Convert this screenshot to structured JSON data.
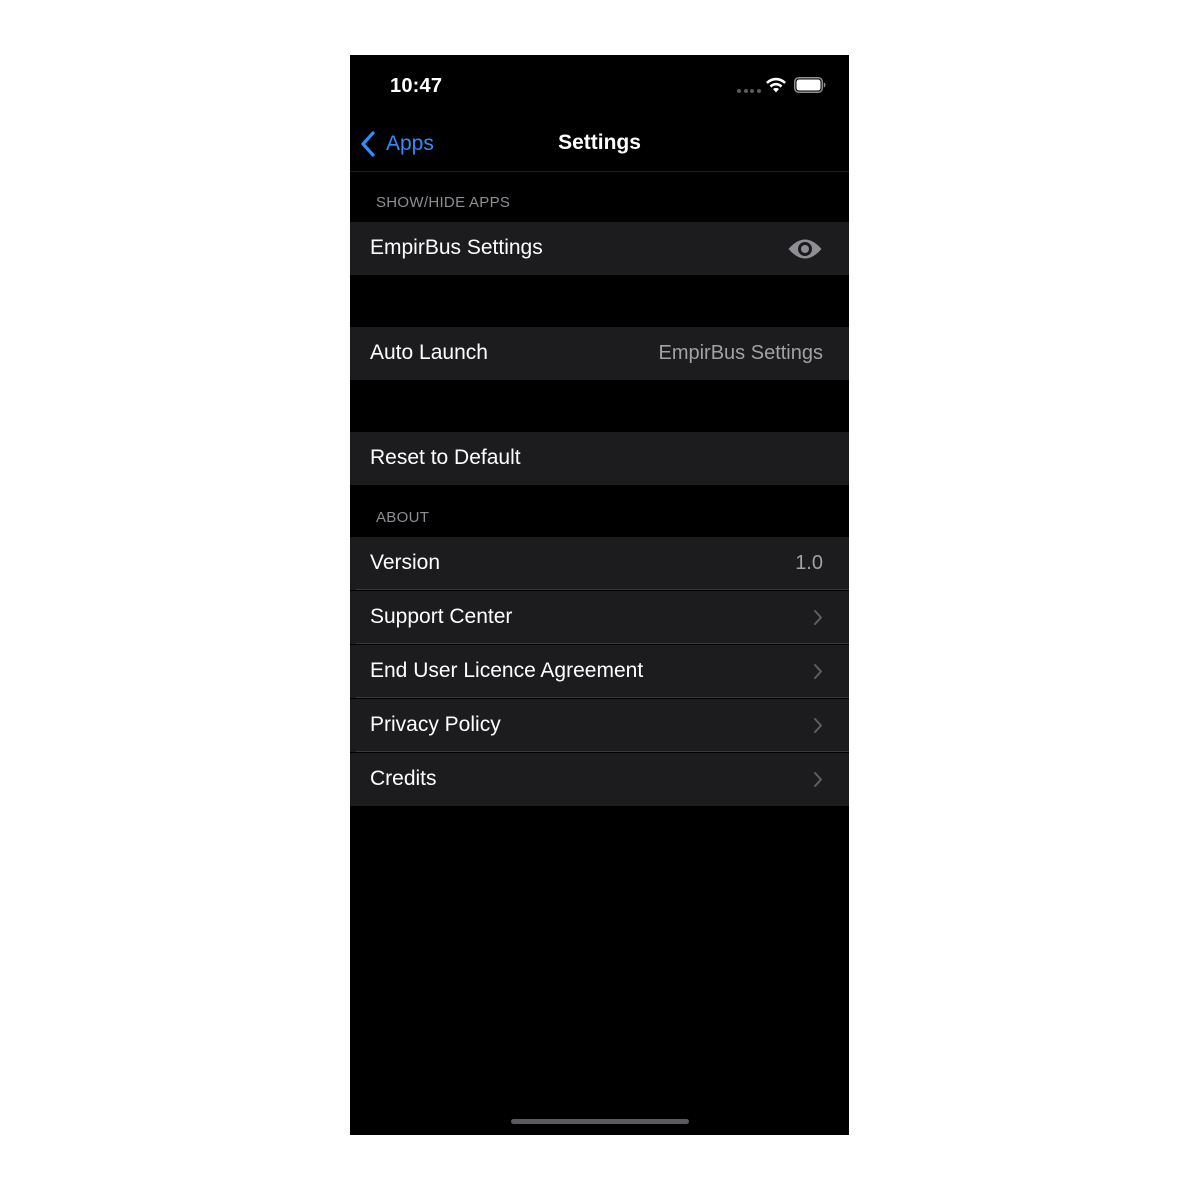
{
  "status_bar": {
    "time": "10:47"
  },
  "nav": {
    "back_label": "Apps",
    "title": "Settings"
  },
  "sections": {
    "show_hide_header": "SHOW/HIDE APPS",
    "about_header": "ABOUT"
  },
  "cells": {
    "empirbus": {
      "label": "EmpirBus Settings",
      "icon": "eye-icon"
    },
    "auto_launch": {
      "label": "Auto Launch",
      "value": "EmpirBus Settings"
    },
    "reset": {
      "label": "Reset to Default"
    },
    "version": {
      "label": "Version",
      "value": "1.0"
    },
    "support": {
      "label": "Support Center"
    },
    "eula": {
      "label": "End User Licence Agreement"
    },
    "privacy": {
      "label": "Privacy Policy"
    },
    "credits": {
      "label": "Credits"
    }
  },
  "colors": {
    "accent": "#2f8dff",
    "background": "#000000",
    "cell_background": "#1c1c1e",
    "secondary_text": "#a1a1a6"
  }
}
